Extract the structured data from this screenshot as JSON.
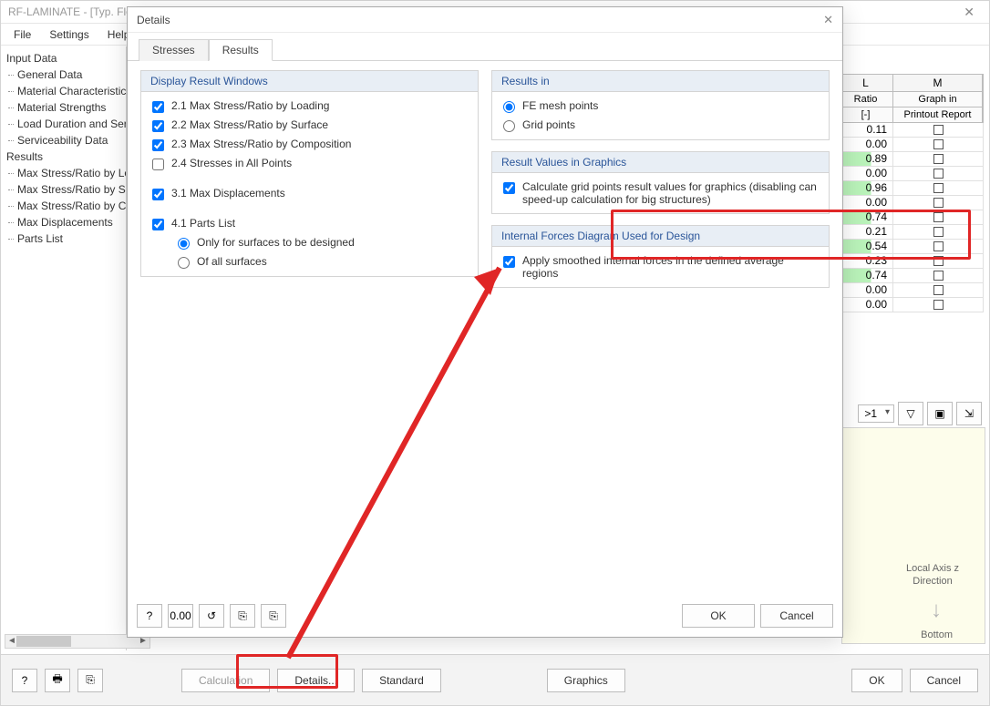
{
  "window_title": "RF-LAMINATE - [Typ. Floo",
  "menubar": {
    "file": "File",
    "settings": "Settings",
    "help": "Help"
  },
  "nav": {
    "input_data": "Input Data",
    "general_data": "General Data",
    "material_characteristics": "Material Characteristics",
    "material_strengths": "Material Strengths",
    "load_duration": "Load Duration and Serv",
    "serviceability": "Serviceability Data",
    "results": "Results",
    "max_by_loading": "Max Stress/Ratio by Lo",
    "max_by_surface": "Max Stress/Ratio by Su",
    "max_by_composition": "Max Stress/Ratio by Co",
    "max_displacements": "Max Displacements",
    "parts_list": "Parts List"
  },
  "table": {
    "col_l": "L",
    "col_m": "M",
    "ratio_label": "Ratio",
    "ratio_unit": "[-]",
    "graph_label": "Graph in",
    "report_label": "Printout Report",
    "rows": [
      {
        "ratio": "0.11",
        "green": false
      },
      {
        "ratio": "0.00",
        "green": false
      },
      {
        "ratio": "0.89",
        "green": true
      },
      {
        "ratio": "0.00",
        "green": false
      },
      {
        "ratio": "0.96",
        "green": true
      },
      {
        "ratio": "0.00",
        "green": false
      },
      {
        "ratio": "0.74",
        "green": true
      },
      {
        "ratio": "0.21",
        "green": false
      },
      {
        "ratio": "0.54",
        "green": true
      },
      {
        "ratio": "0.23",
        "green": false
      },
      {
        "ratio": "0.74",
        "green": true
      },
      {
        "ratio": "0.00",
        "green": false
      },
      {
        "ratio": "0.00",
        "green": false
      }
    ]
  },
  "toolbar_right": {
    "select_value": ">1"
  },
  "axis": {
    "label": "Local Axis z Direction",
    "bottom": "Bottom"
  },
  "dialog": {
    "title": "Details",
    "tabs": {
      "stresses": "Stresses",
      "results": "Results"
    },
    "group_display": {
      "title": "Display Result Windows",
      "c21": "2.1 Max Stress/Ratio by Loading",
      "c22": "2.2 Max Stress/Ratio by Surface",
      "c23": "2.3 Max Stress/Ratio by Composition",
      "c24": "2.4 Stresses in All Points",
      "c31": "3.1 Max Displacements",
      "c41": "4.1 Parts List",
      "r_only": "Only for surfaces to be designed",
      "r_all": "Of all surfaces"
    },
    "group_results_in": {
      "title": "Results in",
      "r_fe": "FE mesh points",
      "r_grid": "Grid points"
    },
    "group_values": {
      "title": "Result Values in Graphics",
      "chk": "Calculate grid points result values for graphics (disabling can speed-up calculation for big structures)"
    },
    "group_forces": {
      "title": "Internal Forces Diagram Used for Design",
      "chk": "Apply smoothed internal forces in the defined average regions"
    },
    "buttons": {
      "ok": "OK",
      "cancel": "Cancel"
    }
  },
  "bottom": {
    "calculation": "Calculation",
    "details": "Details...",
    "standard": "Standard",
    "graphics": "Graphics",
    "ok": "OK",
    "cancel": "Cancel"
  }
}
